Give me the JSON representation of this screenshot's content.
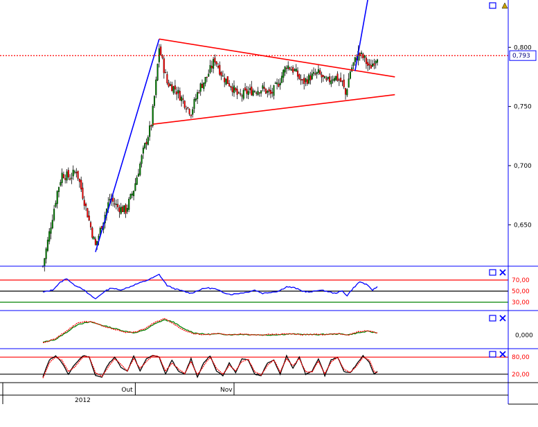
{
  "chart_data": [
    {
      "type": "candlestick",
      "panel": "price",
      "ylim": [
        0.615,
        0.84
      ],
      "y_ticks": [
        0.65,
        0.7,
        0.75,
        0.8
      ],
      "y_tick_labels": [
        "0,650",
        "0,700",
        "0,750",
        "0,800"
      ],
      "current_value": 0.793,
      "current_label": "0,793",
      "anchors": [
        [
          0,
          0.615
        ],
        [
          5,
          0.65
        ],
        [
          9,
          0.678
        ],
        [
          12,
          0.693
        ],
        [
          17,
          0.69
        ],
        [
          21,
          0.696
        ],
        [
          26,
          0.67
        ],
        [
          30,
          0.648
        ],
        [
          33,
          0.632
        ],
        [
          37,
          0.65
        ],
        [
          42,
          0.672
        ],
        [
          47,
          0.665
        ],
        [
          52,
          0.662
        ],
        [
          57,
          0.68
        ],
        [
          63,
          0.712
        ],
        [
          68,
          0.735
        ],
        [
          71,
          0.77
        ],
        [
          73,
          0.8
        ],
        [
          78,
          0.77
        ],
        [
          83,
          0.765
        ],
        [
          88,
          0.755
        ],
        [
          93,
          0.745
        ],
        [
          98,
          0.765
        ],
        [
          103,
          0.775
        ],
        [
          108,
          0.79
        ],
        [
          113,
          0.775
        ],
        [
          118,
          0.768
        ],
        [
          123,
          0.758
        ],
        [
          128,
          0.762
        ],
        [
          133,
          0.764
        ],
        [
          138,
          0.765
        ],
        [
          143,
          0.76
        ],
        [
          148,
          0.77
        ],
        [
          153,
          0.785
        ],
        [
          158,
          0.78
        ],
        [
          163,
          0.77
        ],
        [
          168,
          0.775
        ],
        [
          173,
          0.778
        ],
        [
          178,
          0.77
        ],
        [
          183,
          0.776
        ],
        [
          188,
          0.77
        ],
        [
          190,
          0.76
        ],
        [
          193,
          0.78
        ],
        [
          198,
          0.795
        ],
        [
          202,
          0.79
        ],
        [
          205,
          0.782
        ],
        [
          210,
          0.793
        ]
      ],
      "trendlines": [
        {
          "name": "blue-rise-1",
          "color": "#0000ff",
          "from": [
            33,
            0.627
          ],
          "to": [
            73,
            0.807
          ]
        },
        {
          "name": "triangle-upper",
          "color": "#ff0000",
          "from": [
            73,
            0.807
          ],
          "to": [
            221,
            0.775
          ]
        },
        {
          "name": "triangle-lower",
          "color": "#ff0000",
          "from": [
            69,
            0.735
          ],
          "to": [
            221,
            0.76
          ]
        },
        {
          "name": "blue-breakout",
          "color": "#0000ff",
          "from": [
            196,
            0.78
          ],
          "to": [
            205,
            0.848
          ]
        }
      ]
    },
    {
      "type": "line",
      "panel": "rsi",
      "ylim": [
        20,
        90
      ],
      "levels": [
        {
          "value": 70,
          "label": "70,00",
          "color": "#ff0000"
        },
        {
          "value": 50,
          "label": "50,00",
          "color": "#000000"
        },
        {
          "value": 30,
          "label": "30,00",
          "color": "#008000"
        }
      ],
      "series": [
        {
          "color": "#0000ff",
          "anchors": [
            [
              0,
              48
            ],
            [
              6,
              52
            ],
            [
              11,
              66
            ],
            [
              15,
              73
            ],
            [
              19,
              62
            ],
            [
              24,
              56
            ],
            [
              29,
              44
            ],
            [
              33,
              36
            ],
            [
              38,
              48
            ],
            [
              43,
              56
            ],
            [
              48,
              52
            ],
            [
              53,
              56
            ],
            [
              58,
              62
            ],
            [
              64,
              68
            ],
            [
              69,
              74
            ],
            [
              73,
              80
            ],
            [
              78,
              60
            ],
            [
              83,
              54
            ],
            [
              88,
              50
            ],
            [
              93,
              46
            ],
            [
              98,
              52
            ],
            [
              103,
              56
            ],
            [
              108,
              54
            ],
            [
              113,
              48
            ],
            [
              118,
              44
            ],
            [
              123,
              46
            ],
            [
              128,
              48
            ],
            [
              133,
              52
            ],
            [
              138,
              46
            ],
            [
              143,
              48
            ],
            [
              148,
              50
            ],
            [
              153,
              58
            ],
            [
              158,
              56
            ],
            [
              163,
              50
            ],
            [
              168,
              48
            ],
            [
              173,
              52
            ],
            [
              178,
              50
            ],
            [
              183,
              46
            ],
            [
              188,
              50
            ],
            [
              191,
              42
            ],
            [
              195,
              56
            ],
            [
              199,
              67
            ],
            [
              203,
              62
            ],
            [
              207,
              52
            ],
            [
              210,
              58
            ]
          ]
        }
      ]
    },
    {
      "type": "line",
      "panel": "oscillator",
      "ylim": [
        -0.03,
        0.06
      ],
      "y_ticks": [
        0
      ],
      "y_tick_labels": [
        "0,000"
      ],
      "series": [
        {
          "color": "#008000",
          "anchors": [
            [
              0,
              -0.02
            ],
            [
              8,
              -0.012
            ],
            [
              15,
              0.008
            ],
            [
              22,
              0.03
            ],
            [
              30,
              0.036
            ],
            [
              38,
              0.026
            ],
            [
              45,
              0.018
            ],
            [
              52,
              0.01
            ],
            [
              58,
              0.006
            ],
            [
              64,
              0.014
            ],
            [
              70,
              0.03
            ],
            [
              76,
              0.042
            ],
            [
              82,
              0.036
            ],
            [
              88,
              0.018
            ],
            [
              95,
              0.006
            ],
            [
              102,
              0.002
            ],
            [
              110,
              0.003
            ],
            [
              118,
              0.001
            ],
            [
              125,
              0.002
            ],
            [
              132,
              0.001
            ],
            [
              140,
              0.0
            ],
            [
              148,
              0.001
            ],
            [
              155,
              0.003
            ],
            [
              162,
              0.002
            ],
            [
              170,
              0.001
            ],
            [
              178,
              0.002
            ],
            [
              186,
              0.003
            ],
            [
              192,
              0.001
            ],
            [
              198,
              0.006
            ],
            [
              204,
              0.01
            ],
            [
              210,
              0.006
            ]
          ]
        },
        {
          "color": "#ff0000",
          "anchors": [
            [
              0,
              -0.022
            ],
            [
              8,
              -0.01
            ],
            [
              15,
              0.012
            ],
            [
              22,
              0.034
            ],
            [
              30,
              0.038
            ],
            [
              38,
              0.024
            ],
            [
              45,
              0.016
            ],
            [
              52,
              0.008
            ],
            [
              58,
              0.008
            ],
            [
              64,
              0.018
            ],
            [
              70,
              0.034
            ],
            [
              76,
              0.046
            ],
            [
              82,
              0.032
            ],
            [
              88,
              0.014
            ],
            [
              95,
              0.004
            ],
            [
              102,
              0.001
            ],
            [
              110,
              0.004
            ],
            [
              118,
              0.0
            ],
            [
              125,
              0.003
            ],
            [
              132,
              0.0
            ],
            [
              140,
              0.001
            ],
            [
              148,
              0.002
            ],
            [
              155,
              0.004
            ],
            [
              162,
              0.001
            ],
            [
              170,
              0.002
            ],
            [
              178,
              0.001
            ],
            [
              186,
              0.004
            ],
            [
              192,
              0.0
            ],
            [
              198,
              0.009
            ],
            [
              204,
              0.012
            ],
            [
              210,
              0.005
            ]
          ]
        }
      ]
    },
    {
      "type": "line",
      "panel": "stochastic",
      "ylim": [
        0,
        100
      ],
      "levels": [
        {
          "value": 80,
          "label": "80,00",
          "color": "#ff0000"
        },
        {
          "value": 20,
          "label": "20,00",
          "color": "#000000"
        }
      ],
      "series": [
        {
          "color": "#000000",
          "anchors": [
            [
              0,
              10
            ],
            [
              4,
              70
            ],
            [
              8,
              85
            ],
            [
              12,
              60
            ],
            [
              16,
              20
            ],
            [
              20,
              55
            ],
            [
              25,
              85
            ],
            [
              29,
              80
            ],
            [
              33,
              15
            ],
            [
              37,
              10
            ],
            [
              41,
              55
            ],
            [
              45,
              80
            ],
            [
              49,
              45
            ],
            [
              53,
              30
            ],
            [
              57,
              85
            ],
            [
              61,
              30
            ],
            [
              65,
              75
            ],
            [
              69,
              85
            ],
            [
              73,
              80
            ],
            [
              77,
              20
            ],
            [
              81,
              70
            ],
            [
              85,
              30
            ],
            [
              89,
              20
            ],
            [
              93,
              75
            ],
            [
              97,
              10
            ],
            [
              101,
              60
            ],
            [
              105,
              85
            ],
            [
              109,
              30
            ],
            [
              113,
              15
            ],
            [
              117,
              60
            ],
            [
              121,
              25
            ],
            [
              125,
              75
            ],
            [
              129,
              70
            ],
            [
              133,
              20
            ],
            [
              137,
              15
            ],
            [
              141,
              60
            ],
            [
              145,
              70
            ],
            [
              149,
              20
            ],
            [
              153,
              85
            ],
            [
              157,
              40
            ],
            [
              161,
              80
            ],
            [
              165,
              20
            ],
            [
              169,
              30
            ],
            [
              173,
              75
            ],
            [
              177,
              15
            ],
            [
              181,
              70
            ],
            [
              185,
              80
            ],
            [
              189,
              30
            ],
            [
              193,
              25
            ],
            [
              197,
              55
            ],
            [
              201,
              85
            ],
            [
              205,
              60
            ],
            [
              208,
              20
            ],
            [
              210,
              30
            ]
          ]
        },
        {
          "color": "#ff0000",
          "anchors": [
            [
              0,
              5
            ],
            [
              4,
              60
            ],
            [
              8,
              80
            ],
            [
              12,
              68
            ],
            [
              16,
              30
            ],
            [
              20,
              45
            ],
            [
              25,
              80
            ],
            [
              29,
              83
            ],
            [
              33,
              25
            ],
            [
              37,
              12
            ],
            [
              41,
              45
            ],
            [
              45,
              75
            ],
            [
              49,
              55
            ],
            [
              53,
              32
            ],
            [
              57,
              75
            ],
            [
              61,
              40
            ],
            [
              65,
              65
            ],
            [
              69,
              85
            ],
            [
              73,
              82
            ],
            [
              77,
              30
            ],
            [
              81,
              60
            ],
            [
              85,
              40
            ],
            [
              89,
              22
            ],
            [
              93,
              65
            ],
            [
              97,
              18
            ],
            [
              101,
              50
            ],
            [
              105,
              80
            ],
            [
              109,
              40
            ],
            [
              113,
              20
            ],
            [
              117,
              50
            ],
            [
              121,
              32
            ],
            [
              125,
              65
            ],
            [
              129,
              72
            ],
            [
              133,
              28
            ],
            [
              137,
              18
            ],
            [
              141,
              50
            ],
            [
              145,
              70
            ],
            [
              149,
              28
            ],
            [
              153,
              75
            ],
            [
              157,
              50
            ],
            [
              161,
              75
            ],
            [
              165,
              28
            ],
            [
              169,
              28
            ],
            [
              173,
              65
            ],
            [
              177,
              22
            ],
            [
              181,
              62
            ],
            [
              185,
              80
            ],
            [
              189,
              38
            ],
            [
              193,
              26
            ],
            [
              197,
              48
            ],
            [
              201,
              80
            ],
            [
              205,
              70
            ],
            [
              208,
              28
            ],
            [
              210,
              25
            ]
          ]
        }
      ]
    }
  ],
  "x_axis": {
    "tick_labels": [
      {
        "label": "Out",
        "bar": 58
      },
      {
        "label": "Nov",
        "bar": 120
      }
    ],
    "year_label": "2012"
  },
  "controls": {
    "restore_symbol": "□",
    "close_symbol": "✕",
    "alert_symbol": "▲"
  },
  "colors": {
    "candle_up": "#008000",
    "candle_down": "#ff0000",
    "frame": "#0000ff",
    "price_label_border": "#0000ff",
    "level_label": "#ff0000"
  }
}
